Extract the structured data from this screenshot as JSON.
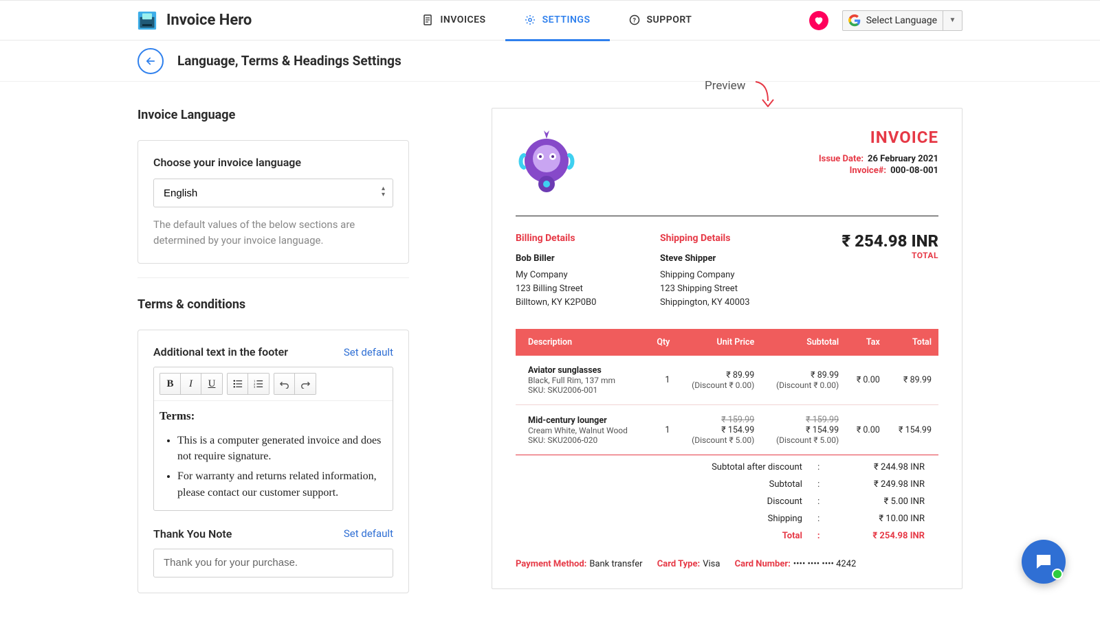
{
  "brand": {
    "name": "Invoice Hero"
  },
  "nav": {
    "invoices": "INVOICES",
    "settings": "SETTINGS",
    "support": "SUPPORT"
  },
  "lang_picker": "Select Language",
  "page": {
    "title": "Language, Terms & Headings Settings"
  },
  "section_language": {
    "heading": "Invoice Language",
    "choose_label": "Choose your invoice language",
    "value": "English",
    "helper": "The default values of the below sections are determined by your invoice language."
  },
  "section_terms": {
    "heading": "Terms & conditions",
    "footer_label": "Additional text in the footer",
    "set_default": "Set default",
    "terms_head": "Terms:",
    "bullets": [
      "This is a computer generated invoice and does not require signature.",
      "For warranty and returns related information, please contact our customer support."
    ],
    "thanks_label": "Thank You Note",
    "thanks_value": "Thank you for your purchase."
  },
  "preview": {
    "label": "Preview",
    "title": "INVOICE",
    "issue_label": "Issue Date:",
    "issue_value": "26 February 2021",
    "num_label": "Invoice#:",
    "num_value": "000-08-001",
    "billing_head": "Billing Details",
    "billing": {
      "name": "Bob Biller",
      "company": "My Company",
      "street": "123 Billing Street",
      "city": "Billtown, KY K2P0B0"
    },
    "shipping_head": "Shipping Details",
    "shipping": {
      "name": "Steve Shipper",
      "company": "Shipping Company",
      "street": "123 Shipping Street",
      "city": "Shippington, KY 40003"
    },
    "total": "₹ 254.98 INR",
    "total_label": "TOTAL",
    "cols": {
      "desc": "Description",
      "qty": "Qty",
      "unit": "Unit Price",
      "subtotal": "Subtotal",
      "tax": "Tax",
      "total": "Total"
    },
    "items": [
      {
        "name": "Aviator sunglasses",
        "variant": "Black, Full Rim, 137 mm",
        "sku": "SKU: SKU2006-001",
        "qty": "1",
        "unit": "₹ 89.99",
        "unit_disc": "(Discount ₹ 0.00)",
        "sub": "₹ 89.99",
        "sub_disc": "(Discount ₹ 0.00)",
        "tax": "₹ 0.00",
        "total": "₹ 89.99",
        "strike_unit": "",
        "strike_sub": ""
      },
      {
        "name": "Mid-century lounger",
        "variant": "Cream White, Walnut Wood",
        "sku": "SKU: SKU2006-020",
        "qty": "1",
        "unit": "₹ 154.99",
        "unit_disc": "(Discount ₹ 5.00)",
        "sub": "₹ 154.99",
        "sub_disc": "(Discount ₹ 5.00)",
        "tax": "₹ 0.00",
        "total": "₹ 154.99",
        "strike_unit": "₹ 159.99",
        "strike_sub": "₹ 159.99"
      }
    ],
    "summary": {
      "sub_after_disc_l": "Subtotal after discount",
      "sub_after_disc_v": "₹ 244.98 INR",
      "subtotal_l": "Subtotal",
      "subtotal_v": "₹ 249.98 INR",
      "discount_l": "Discount",
      "discount_v": "₹ 5.00 INR",
      "shipping_l": "Shipping",
      "shipping_v": "₹ 10.00 INR",
      "total_l": "Total",
      "total_v": "₹ 254.98 INR"
    },
    "pay": {
      "method_l": "Payment Method:",
      "method_v": "Bank transfer",
      "cardtype_l": "Card Type:",
      "cardtype_v": "Visa",
      "cardnum_l": "Card Number:",
      "cardnum_v": "•••• •••• •••• 4242"
    }
  }
}
